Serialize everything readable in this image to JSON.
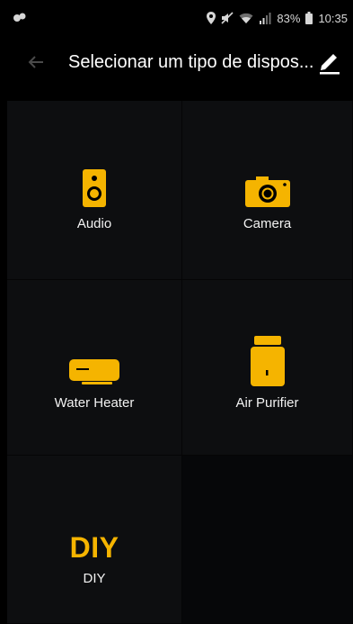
{
  "status_bar": {
    "battery": "83%",
    "time": "10:35"
  },
  "app_bar": {
    "title": "Selecionar um tipo de dispos..."
  },
  "devices": [
    {
      "label": "Audio",
      "icon": "speaker-icon"
    },
    {
      "label": "Camera",
      "icon": "camera-icon"
    },
    {
      "label": "Water Heater",
      "icon": "water-heater-icon"
    },
    {
      "label": "Air Purifier",
      "icon": "air-purifier-icon"
    },
    {
      "label": "DIY",
      "icon": "diy-icon",
      "icon_text": "DIY"
    }
  ],
  "colors": {
    "accent": "#f5b400",
    "background": "#000000",
    "tile": "#0d0e10"
  }
}
